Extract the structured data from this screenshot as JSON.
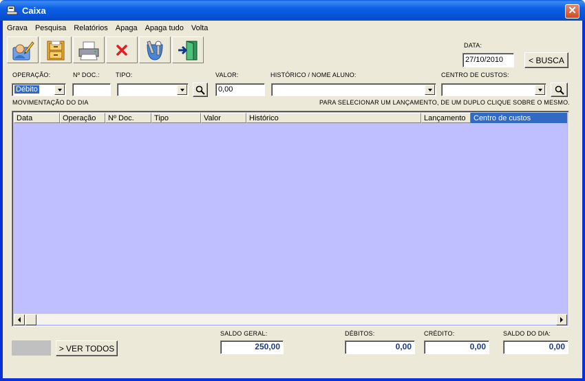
{
  "window": {
    "title": "Caixa"
  },
  "menu": [
    "Grava",
    "Pesquisa",
    "Relatórios",
    "Apaga",
    "Apaga tudo",
    "Volta"
  ],
  "toolbar": [
    "user-edit-icon",
    "file-cabinet-icon",
    "printer-icon",
    "delete-x-icon",
    "tools-icon",
    "exit-door-icon"
  ],
  "date": {
    "label": "DATA:",
    "value": "27/10/2010",
    "search_label": "< BUSCA"
  },
  "form": {
    "operacao_label": "OPERAÇÃO:",
    "operacao_value": "Débito",
    "ndoc_label": "Nº DOC.:",
    "tipo_label": "TIPO:",
    "valor_label": "VALOR:",
    "valor_value": "0,00",
    "historico_label": "HISTÓRICO / NOME ALUNO:",
    "centro_label": "CENTRO DE CUSTOS:"
  },
  "grid": {
    "title": "MOVIMENTAÇÃO DO DIA",
    "hint": "PARA SELECIONAR UM LANÇAMENTO, DE UM DUPLO CLIQUE SOBRE O MESMO.",
    "columns": [
      "Data",
      "Operação",
      "Nº Doc.",
      "Tipo",
      "Valor",
      "Histórico",
      "Lançamento",
      "Centro de custos"
    ],
    "rows": []
  },
  "footer": {
    "ver_todos": "> VER TODOS",
    "saldo_geral_label": "SALDO GERAL:",
    "saldo_geral_value": "250,00",
    "debitos_label": "DÉBITOS:",
    "debitos_value": "0,00",
    "credito_label": "CRÉDITO:",
    "credito_value": "0,00",
    "saldo_dia_label": "SALDO DO DIA:",
    "saldo_dia_value": "0,00"
  },
  "colors": {
    "grid_bg": "#bfbfff",
    "selected_header": "#316ac5",
    "value_text": "#1f3b7a"
  }
}
